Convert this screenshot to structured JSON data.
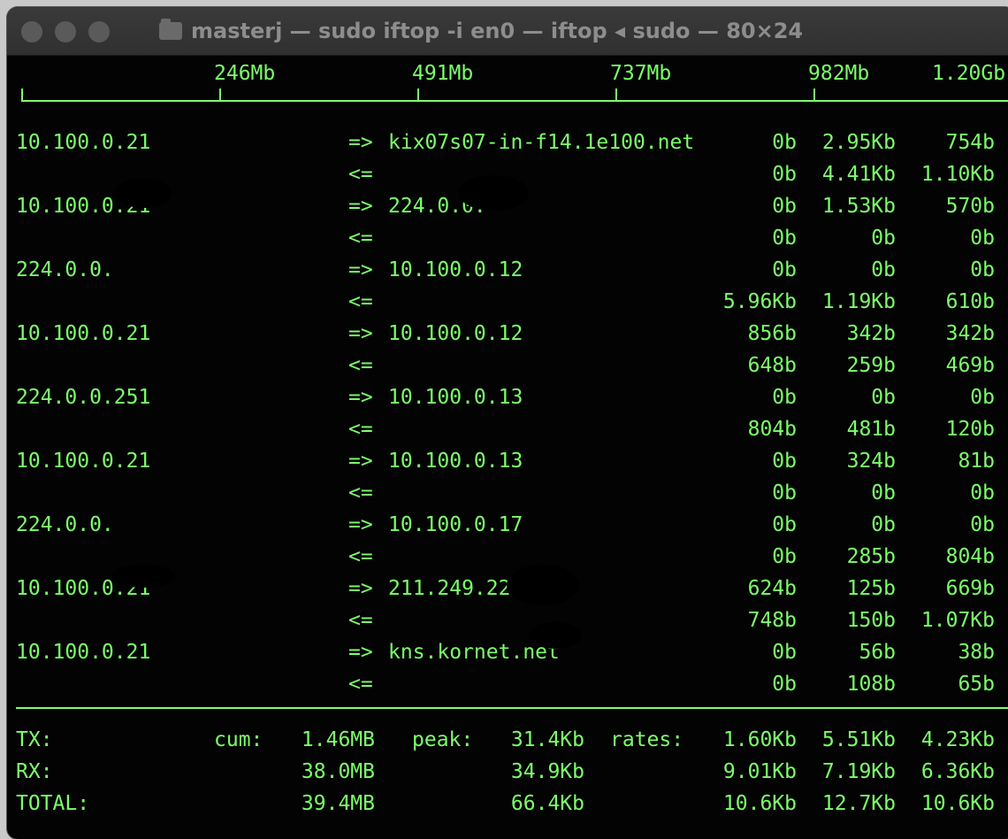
{
  "window": {
    "title": "masterj — sudo iftop -i en0 — iftop ◂ sudo — 80×24",
    "folder_icon": "folder-icon"
  },
  "scale": {
    "ticks": [
      "246Mb",
      "491Mb",
      "737Mb",
      "982Mb",
      "1.20Gb"
    ]
  },
  "connections": [
    {
      "src": "10.100.0.21",
      "dst": "kix07s07-in-f14.1e100.net",
      "out": [
        "0b",
        "2.95Kb",
        "754b"
      ],
      "in": [
        "0b",
        "4.41Kb",
        "1.10Kb"
      ]
    },
    {
      "src": "10.100.0.21",
      "dst": "224.0.0.",
      "out": [
        "0b",
        "1.53Kb",
        "570b"
      ],
      "in": [
        "0b",
        "0b",
        "0b"
      ]
    },
    {
      "src": "224.0.0.",
      "dst": "10.100.0.12",
      "out": [
        "0b",
        "0b",
        "0b"
      ],
      "in": [
        "5.96Kb",
        "1.19Kb",
        "610b"
      ]
    },
    {
      "src": "10.100.0.21",
      "dst": "10.100.0.12",
      "out": [
        "856b",
        "342b",
        "342b"
      ],
      "in": [
        "648b",
        "259b",
        "469b"
      ]
    },
    {
      "src": "224.0.0.251",
      "dst": "10.100.0.13",
      "out": [
        "0b",
        "0b",
        "0b"
      ],
      "in": [
        "804b",
        "481b",
        "120b"
      ]
    },
    {
      "src": "10.100.0.21",
      "dst": "10.100.0.13",
      "out": [
        "0b",
        "324b",
        "81b"
      ],
      "in": [
        "0b",
        "0b",
        "0b"
      ]
    },
    {
      "src": "224.0.0.",
      "dst": "10.100.0.17",
      "out": [
        "0b",
        "0b",
        "0b"
      ],
      "in": [
        "0b",
        "285b",
        "804b"
      ]
    },
    {
      "src": "10.100.0.21",
      "dst": "211.249.222.",
      "out": [
        "624b",
        "125b",
        "669b"
      ],
      "in": [
        "748b",
        "150b",
        "1.07Kb"
      ]
    },
    {
      "src": "10.100.0.21",
      "dst": "kns.kornet.net",
      "out": [
        "0b",
        "56b",
        "38b"
      ],
      "in": [
        "0b",
        "108b",
        "65b"
      ]
    }
  ],
  "arrows": {
    "out": "=>",
    "in": "<="
  },
  "totals": {
    "cum_label": "cum:",
    "peak_label": "peak:",
    "rates_label": "rates:",
    "rows": [
      {
        "label": "TX:",
        "cum": "1.46MB",
        "peak": "31.4Kb",
        "rates": [
          "1.60Kb",
          "5.51Kb",
          "4.23Kb"
        ]
      },
      {
        "label": "RX:",
        "cum": "38.0MB",
        "peak": "34.9Kb",
        "rates": [
          "9.01Kb",
          "7.19Kb",
          "6.36Kb"
        ]
      },
      {
        "label": "TOTAL:",
        "cum": "39.4MB",
        "peak": "66.4Kb",
        "rates": [
          "10.6Kb",
          "12.7Kb",
          "10.6Kb"
        ]
      }
    ]
  },
  "colors": {
    "terminal_text": "#7dff6b",
    "terminal_bg": "#030303"
  }
}
